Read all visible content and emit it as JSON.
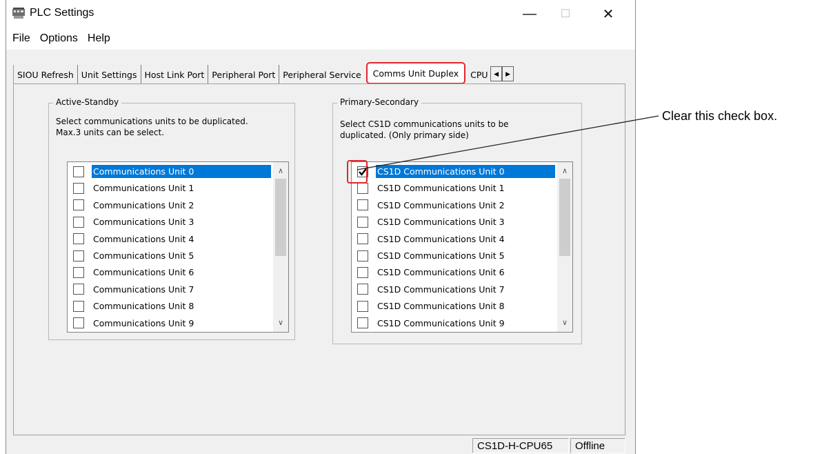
{
  "window": {
    "title": "PLC Settings",
    "minimize_glyph": "—",
    "maximize_glyph": "☐",
    "close_glyph": "✕"
  },
  "menu": [
    "File",
    "Options",
    "Help"
  ],
  "tabs": [
    {
      "label": "SIOU Refresh"
    },
    {
      "label": "Unit Settings"
    },
    {
      "label": "Host Link Port"
    },
    {
      "label": "Peripheral Port"
    },
    {
      "label": "Peripheral Service"
    },
    {
      "label": "Comms Unit Duplex",
      "active": true
    },
    {
      "label": "CPU"
    }
  ],
  "tab_scroll": {
    "left": "◀",
    "right": "▶"
  },
  "active_standby": {
    "legend": "Active-Standby",
    "description": "Select communications units to be duplicated.\nMax.3 units can be select.",
    "items": [
      {
        "label": "Communications Unit 0",
        "checked": false,
        "selected": true
      },
      {
        "label": "Communications Unit 1",
        "checked": false
      },
      {
        "label": "Communications Unit 2",
        "checked": false
      },
      {
        "label": "Communications Unit 3",
        "checked": false
      },
      {
        "label": "Communications Unit 4",
        "checked": false
      },
      {
        "label": "Communications Unit 5",
        "checked": false
      },
      {
        "label": "Communications Unit 6",
        "checked": false
      },
      {
        "label": "Communications Unit 7",
        "checked": false
      },
      {
        "label": "Communications Unit 8",
        "checked": false
      },
      {
        "label": "Communications Unit 9",
        "checked": false
      }
    ]
  },
  "primary_secondary": {
    "legend": "Primary-Secondary",
    "description": "Select CS1D communications units to be\nduplicated. (Only primary side)",
    "items": [
      {
        "label": "CS1D Communications Unit 0",
        "checked": true,
        "selected": true
      },
      {
        "label": "CS1D Communications Unit 1",
        "checked": false
      },
      {
        "label": "CS1D Communications Unit 2",
        "checked": false
      },
      {
        "label": "CS1D Communications Unit 3",
        "checked": false
      },
      {
        "label": "CS1D Communications Unit 4",
        "checked": false
      },
      {
        "label": "CS1D Communications Unit 5",
        "checked": false
      },
      {
        "label": "CS1D Communications Unit 6",
        "checked": false
      },
      {
        "label": "CS1D Communications Unit 7",
        "checked": false
      },
      {
        "label": "CS1D Communications Unit 8",
        "checked": false
      },
      {
        "label": "CS1D Communications Unit 9",
        "checked": false
      }
    ]
  },
  "scroll_glyphs": {
    "up": "∧",
    "down": "∨"
  },
  "status": {
    "model": "CS1D-H-CPU65",
    "mode": "Offline"
  },
  "annotation": {
    "text": "Clear this check box."
  },
  "colors": {
    "highlight": "#e0262e",
    "selection": "#0078d7"
  }
}
